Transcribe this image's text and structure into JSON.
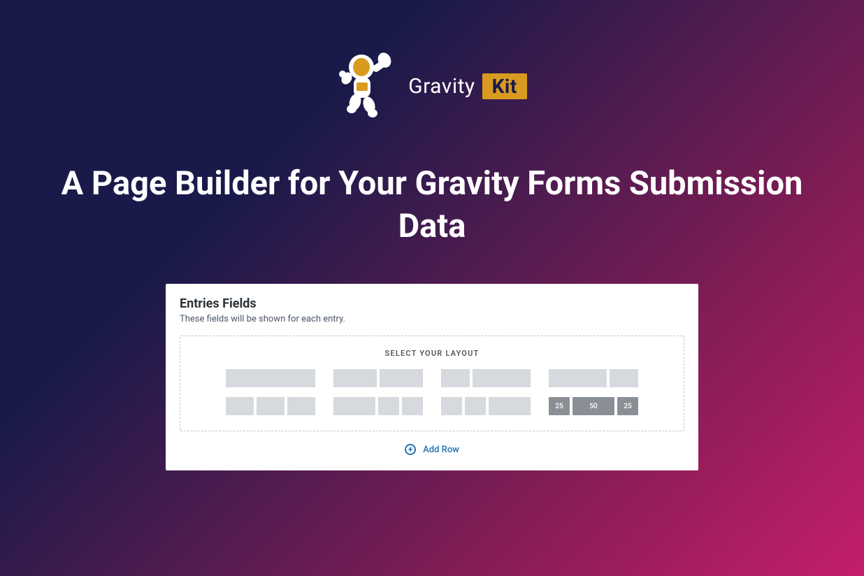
{
  "brand": {
    "name": "Gravity",
    "badge": "Kit"
  },
  "headline": "A Page Builder for Your Gravity Forms Submission Data",
  "panel": {
    "title": "Entries Fields",
    "subtitle": "These fields will be shown for each entry.",
    "layoutLabel": "SELECT YOUR LAYOUT",
    "addRow": "Add Row",
    "activeLayout": {
      "labels": [
        "25",
        "50",
        "25"
      ]
    }
  }
}
